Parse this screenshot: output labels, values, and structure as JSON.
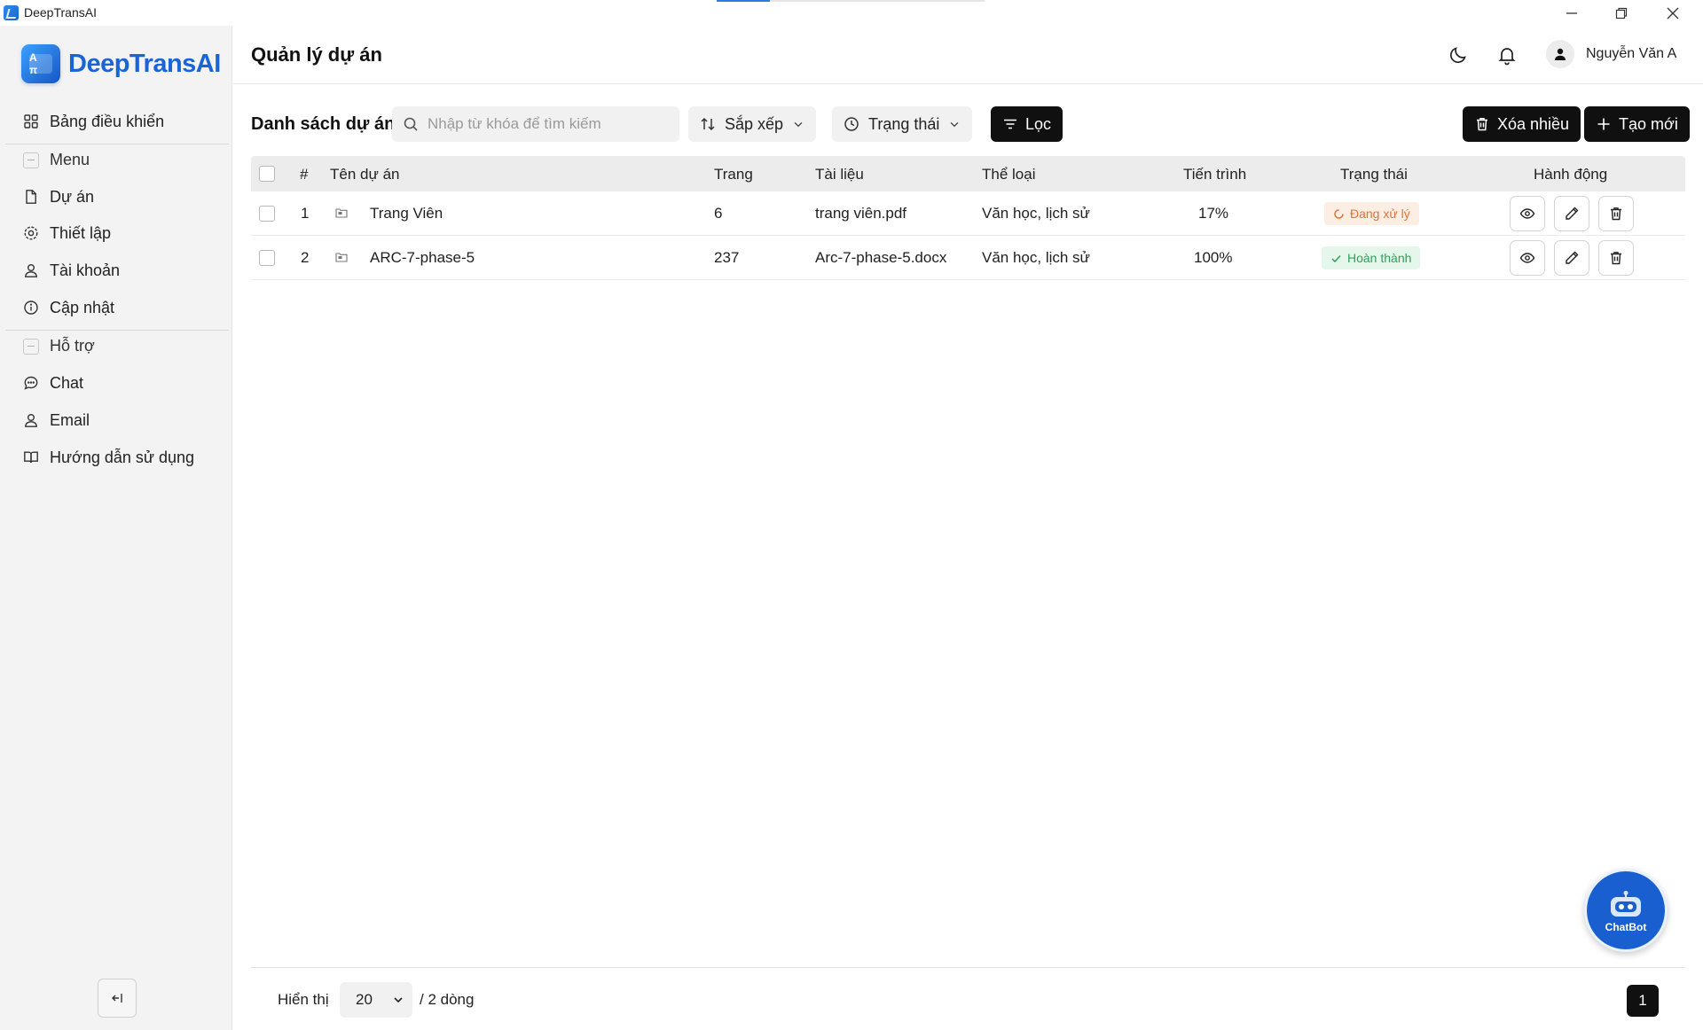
{
  "window": {
    "title": "DeepTransAI",
    "loading_progress": 0.2
  },
  "sidebar": {
    "logo_text": "DeepTransAI",
    "logo_mark": "A π",
    "items": [
      {
        "label": "Bảng điều khiển",
        "icon": "dashboard-icon"
      },
      {
        "label": "Menu",
        "icon": "section-icon"
      },
      {
        "label": "Dự án",
        "icon": "file-icon"
      },
      {
        "label": "Thiết lập",
        "icon": "gear-icon"
      },
      {
        "label": "Tài khoản",
        "icon": "user-icon"
      },
      {
        "label": "Cập nhật",
        "icon": "info-icon"
      },
      {
        "label": "Hỗ trợ",
        "icon": "section-icon"
      },
      {
        "label": "Chat",
        "icon": "chat-icon"
      },
      {
        "label": "Email",
        "icon": "user-icon"
      },
      {
        "label": "Hướng dẫn sử dụng",
        "icon": "book-icon"
      }
    ]
  },
  "header": {
    "title": "Quản lý dự án",
    "user_name": "Nguyễn Văn A"
  },
  "toolbar": {
    "list_title": "Danh sách dự án",
    "search_placeholder": "Nhập từ khóa để tìm kiếm",
    "sort_label": "Sắp xếp",
    "status_label": "Trạng thái",
    "filter_label": "Lọc",
    "delete_many_label": "Xóa nhiều",
    "create_label": "Tạo mới"
  },
  "table": {
    "columns": [
      "#",
      "Tên dự án",
      "Trang",
      "Tài liệu",
      "Thể loại",
      "Tiến trình",
      "Trạng thái",
      "Hành động"
    ],
    "rows": [
      {
        "index": "1",
        "name": "Trang Viên",
        "pages": "6",
        "document": "trang viên.pdf",
        "genre": "Văn học, lịch sử",
        "progress": "17%",
        "status": "Đang xử lý",
        "status_type": "pending"
      },
      {
        "index": "2",
        "name": "ARC-7-phase-5",
        "pages": "237",
        "document": "Arc-7-phase-5.docx",
        "genre": "Văn học, lịch sử",
        "progress": "100%",
        "status": "Hoàn thành",
        "status_type": "done"
      }
    ]
  },
  "footer": {
    "show_label": "Hiển thị",
    "page_size": "20",
    "total_label": "/ 2 dòng",
    "current_page": "1"
  },
  "chatbot": {
    "label": "ChatBot"
  },
  "colors": {
    "brand": "#1a64d6",
    "pending": "#e2713c",
    "done": "#2da15a",
    "dark_button": "#101010"
  }
}
